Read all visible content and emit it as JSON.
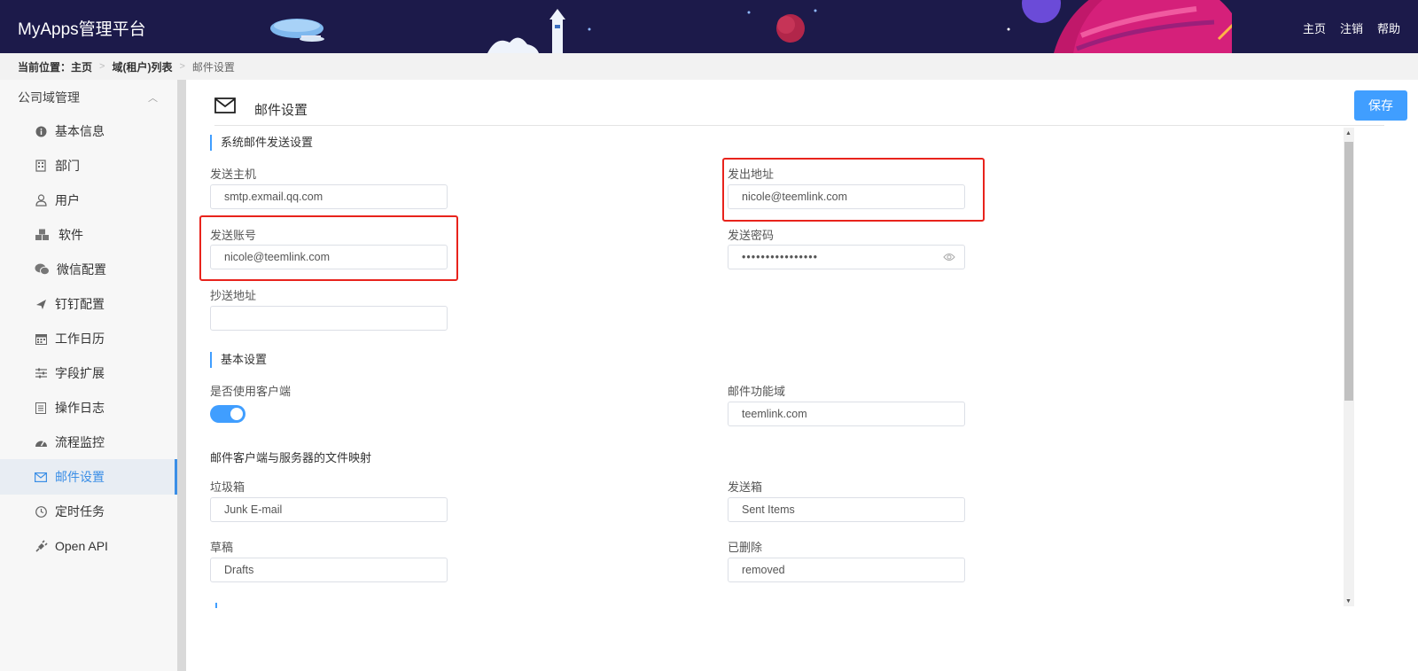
{
  "header": {
    "brand": "MyApps管理平台",
    "nav": [
      "主页",
      "注销",
      "帮助"
    ]
  },
  "breadcrumb": {
    "lead": "当前位置：",
    "items": [
      "主页",
      "域(租户)列表",
      "邮件设置"
    ]
  },
  "sidebar": {
    "group": "公司域管理",
    "items": [
      {
        "label": "基本信息",
        "icon": "info-icon"
      },
      {
        "label": "部门",
        "icon": "building-icon"
      },
      {
        "label": "用户",
        "icon": "user-icon"
      },
      {
        "label": "软件",
        "icon": "cubes-icon"
      },
      {
        "label": "微信配置",
        "icon": "wechat-icon"
      },
      {
        "label": "钉钉配置",
        "icon": "plane-icon"
      },
      {
        "label": "工作日历",
        "icon": "calendar-icon"
      },
      {
        "label": "字段扩展",
        "icon": "sliders-icon"
      },
      {
        "label": "操作日志",
        "icon": "log-icon"
      },
      {
        "label": "流程监控",
        "icon": "dashboard-icon"
      },
      {
        "label": "邮件设置",
        "icon": "mail-icon"
      },
      {
        "label": "定时任务",
        "icon": "clock-icon"
      },
      {
        "label": "Open API",
        "icon": "plug-icon"
      }
    ],
    "active_index": 10
  },
  "main": {
    "title": "邮件设置",
    "save_label": "保存",
    "sections": {
      "smtp": "系统邮件发送设置",
      "basic": "基本设置",
      "mapping": "邮件客户端与服务器的文件映射"
    },
    "fields": {
      "send_host": {
        "label": "发送主机",
        "value": "smtp.exmail.qq.com"
      },
      "from_address": {
        "label": "发出地址",
        "value": "nicole@teemlink.com"
      },
      "send_account": {
        "label": "发送账号",
        "value": "nicole@teemlink.com"
      },
      "send_password": {
        "label": "发送密码",
        "value": "••••••••••••••••"
      },
      "cc_address": {
        "label": "抄送地址",
        "value": ""
      },
      "use_client": {
        "label": "是否使用客户端",
        "enabled": true
      },
      "mail_domain": {
        "label": "邮件功能域",
        "value": "teemlink.com"
      },
      "junk": {
        "label": "垃圾箱",
        "value": "Junk E-mail"
      },
      "sent": {
        "label": "发送箱",
        "value": "Sent Items"
      },
      "drafts": {
        "label": "草稿",
        "value": "Drafts"
      },
      "deleted": {
        "label": "已删除",
        "value": "removed"
      }
    }
  },
  "colors": {
    "accent": "#409eff",
    "header_bg": "#1c1a4a",
    "highlight": "#e8231c"
  }
}
